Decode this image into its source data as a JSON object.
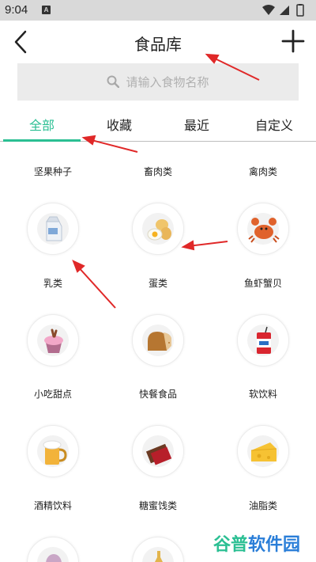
{
  "status_bar": {
    "time": "9:04",
    "notification_badge": "A"
  },
  "header": {
    "title": "食品库",
    "back_icon": "chevron-left-icon",
    "add_icon": "plus-icon"
  },
  "search": {
    "placeholder": "请输入食物名称",
    "icon": "search-icon"
  },
  "tabs": [
    {
      "label": "全部",
      "active": true
    },
    {
      "label": "收藏",
      "active": false
    },
    {
      "label": "最近",
      "active": false
    },
    {
      "label": "自定义",
      "active": false
    }
  ],
  "accent_color": "#2bbf93",
  "top_labels": [
    "坚果种子",
    "畜肉类",
    "禽肉类"
  ],
  "categories": [
    {
      "label": "乳类",
      "icon": "milk-carton-icon"
    },
    {
      "label": "蛋类",
      "icon": "eggs-icon"
    },
    {
      "label": "鱼虾蟹贝",
      "icon": "crab-icon"
    },
    {
      "label": "小吃甜点",
      "icon": "cupcake-icon"
    },
    {
      "label": "快餐食品",
      "icon": "bread-icon"
    },
    {
      "label": "软饮料",
      "icon": "soda-can-icon"
    },
    {
      "label": "酒精饮料",
      "icon": "beer-mug-icon"
    },
    {
      "label": "糖蜜饯类",
      "icon": "chocolate-icon"
    },
    {
      "label": "油脂类",
      "icon": "cheese-icon"
    }
  ],
  "watermark": {
    "part1": "谷普",
    "part2": "软件园"
  }
}
